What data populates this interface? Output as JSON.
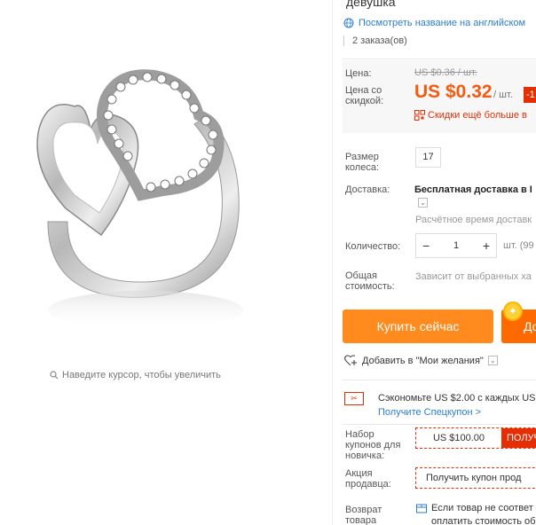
{
  "image_pane": {
    "zoom_hint": "Наведите курсор, чтобы увеличить"
  },
  "product": {
    "title_tail": "девушка",
    "translate_link": "Посмотреть название на английском",
    "orders": "2 заказа(ов)"
  },
  "price": {
    "label": "Цена:",
    "old": "US $0.36 / шт.",
    "discount_label": "Цена со скидкой:",
    "new": "US $0.32",
    "unit": "/ шт.",
    "badge": "-1",
    "app_discount": "Скидки ещё больше в"
  },
  "size": {
    "label": "Размер колеса:",
    "value": "17"
  },
  "shipping": {
    "label": "Доставка:",
    "title": "Бесплатная доставка в I",
    "estimate": "Расчётное время доставк"
  },
  "quantity": {
    "label": "Количество:",
    "minus": "−",
    "value": "1",
    "plus": "+",
    "unit": "шт. (99"
  },
  "total": {
    "label": "Общая стоимость:",
    "value": "Зависит от выбранных ха"
  },
  "actions": {
    "buy_now": "Купить сейчас",
    "add_to_cart": "До"
  },
  "wishlist": {
    "label": "Добавить в \"Мои желания\""
  },
  "coupon": {
    "save_text": "Сэкономьте US $2.00 с каждых US",
    "special_link": "Получите Спецкупон >"
  },
  "newbie": {
    "label": "Набор купонов для новичка:",
    "amount": "US $100.00",
    "get": "ПОЛУЧ"
  },
  "seller": {
    "label": "Акция продавца:",
    "text": "Получить купон прод"
  },
  "returns": {
    "label": "Возврат товара",
    "line1": "Если товар не соответ",
    "line2": "оплатить стоимость об"
  },
  "colors": {
    "price_orange": "#f45a10",
    "buy_orange": "#ff8a1e",
    "cart_orange": "#ff6a00",
    "link_blue": "#2a7ed3",
    "red": "#e62e04"
  }
}
